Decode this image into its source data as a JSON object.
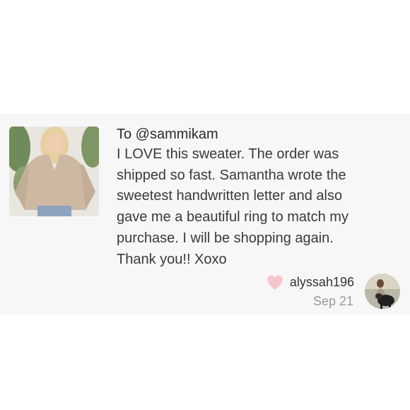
{
  "comment": {
    "to_line": "To @sammikam",
    "body_lines": [
      "I LOVE this sweater. The order was",
      "shipped so fast. Samantha wrote the",
      "sweetest handwritten letter and also",
      "gave me a beautiful ring to match my",
      "purchase. I will be shopping again.",
      "Thank you!! Xoxo"
    ]
  },
  "footer": {
    "username": "alyssah196",
    "date": "Sep 21"
  },
  "icons": {
    "heart": "heart-icon",
    "heart_color": "#f7c6cc"
  },
  "colors": {
    "card_background": "#f7f7f7",
    "text": "#3a3a3a",
    "muted": "#9a9a9a"
  }
}
